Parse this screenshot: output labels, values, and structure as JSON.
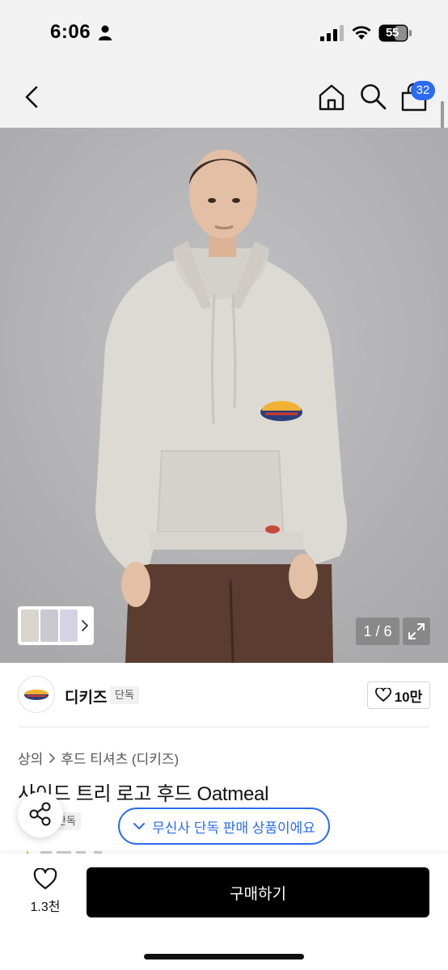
{
  "status_bar": {
    "time": "6:06",
    "battery": "55",
    "icons": [
      "person-icon",
      "cellular-signal-icon",
      "wifi-icon",
      "battery-icon"
    ]
  },
  "nav": {
    "icons": [
      "back-chevron-icon",
      "home-icon",
      "search-icon",
      "cart-bag-icon"
    ],
    "cart_badge": "32"
  },
  "gallery": {
    "counter": "1 / 6",
    "thumbnail_arrow": "chevron-right-icon",
    "expand_icon": "expand-arrows-icon"
  },
  "brand": {
    "name": "디키즈",
    "tag": "단독",
    "like_count": "10만"
  },
  "breadcrumb": {
    "items": [
      "상의",
      "후드 티셔츠 (디키즈)"
    ]
  },
  "product": {
    "title": "사이드 트리 로고 후드 Oatmeal",
    "exclusive_tag": "단독",
    "exclusive_banner": "무신사 단독 판매 상품이에요"
  },
  "bottom_bar": {
    "wish_count": "1.3천",
    "buy_label": "구매하기"
  },
  "colors": {
    "accent_blue": "#2b6bf3",
    "buy_button": "#000000",
    "image_background": "#b7b7b9"
  }
}
